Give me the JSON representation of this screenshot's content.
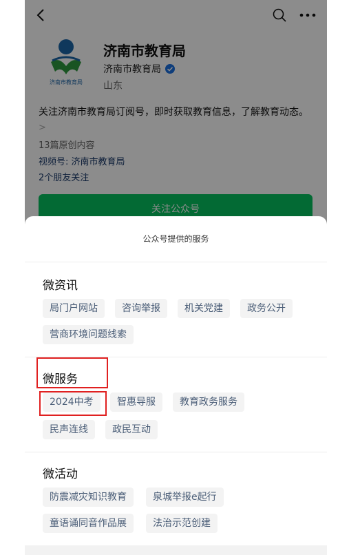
{
  "header": {
    "back_icon": "chevron-left-icon",
    "search_icon": "search-icon",
    "more_icon": "more-dots-icon"
  },
  "profile": {
    "name": "济南市教育局",
    "sub_name": "济南市教育局",
    "verified_icon": "verified-badge-icon",
    "location": "山东",
    "logo_text": "济南市教育局",
    "description": "关注济南市教育局订阅号，即时获取教育信息，了解教育动态。",
    "desc_more": ">",
    "original_count": "13篇原创内容",
    "video_account": "视频号: 济南市教育局",
    "friends_follow": "2个朋友关注",
    "follow_button": "关注公众号"
  },
  "sheet": {
    "title": "公众号提供的服务",
    "sections": [
      {
        "title": "微资讯",
        "items": [
          "局门户网站",
          "咨询举报",
          "机关党建",
          "政务公开",
          "营商环境问题线索"
        ]
      },
      {
        "title": "微服务",
        "items": [
          "2024中考",
          "智惠导服",
          "教育政务服务",
          "民声连线",
          "政民互动"
        ]
      },
      {
        "title": "微活动",
        "items": [
          "防震减灾知识教育",
          "泉城举报e起行",
          "童语诵同音作品展",
          "法治示范创建"
        ]
      }
    ]
  },
  "colors": {
    "accent_green": "#07c160",
    "tag_text": "#4a5d77",
    "highlight_red": "#e02020"
  }
}
